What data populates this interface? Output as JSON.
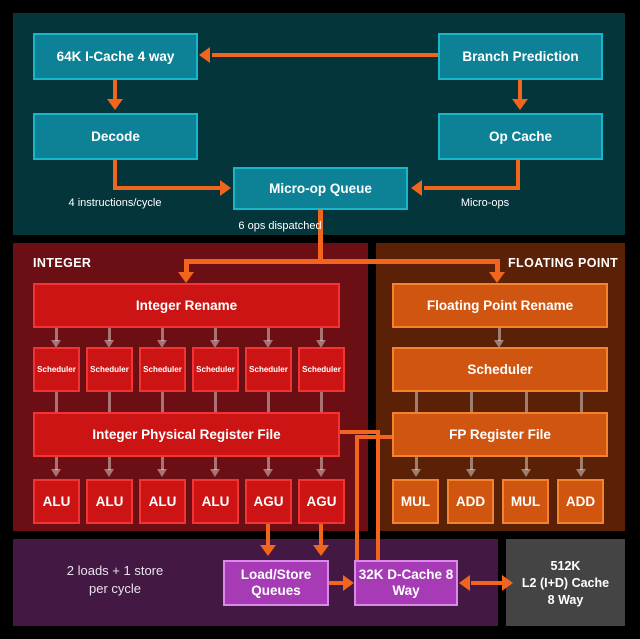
{
  "diagram": {
    "title": "CPU Microarchitecture Block Diagram",
    "background_color": "#000000"
  },
  "colors": {
    "frontend_panel": "#04353b",
    "integer_panel": "#6b0f14",
    "fp_panel": "#5a2107",
    "memory_panel": "#431842",
    "l2_panel": "#444444",
    "teal_box": "#0d8296",
    "teal_border": "#19b6cb",
    "red_box": "#cc1414",
    "red_border": "#f43434",
    "orange_box": "#cf5510",
    "orange_border": "#f3842f",
    "purple_box": "#a63bb5",
    "purple_border": "#d98ae8",
    "arrow": "#f2651c",
    "faint_arrow": "#ffffff"
  },
  "frontend": {
    "icache": "64K I-Cache\n4 way",
    "decode": "Decode",
    "branch_prediction": "Branch Prediction",
    "op_cache": "Op Cache",
    "microop_queue": "Micro-op Queue",
    "label_instructions_per_cycle": "4 instructions/cycle",
    "label_micro_ops": "Micro-ops",
    "label_ops_dispatched": "6 ops dispatched"
  },
  "integer": {
    "section_title": "INTEGER",
    "rename": "Integer Rename",
    "schedulers": [
      "Scheduler",
      "Scheduler",
      "Scheduler",
      "Scheduler",
      "Scheduler",
      "Scheduler"
    ],
    "register_file": "Integer Physical Register File",
    "execution_units": [
      "ALU",
      "ALU",
      "ALU",
      "ALU",
      "AGU",
      "AGU"
    ]
  },
  "floating_point": {
    "section_title": "FLOATING POINT",
    "rename": "Floating Point Rename",
    "scheduler": "Scheduler",
    "register_file": "FP Register File",
    "execution_units": [
      "MUL",
      "ADD",
      "MUL",
      "ADD"
    ]
  },
  "memory": {
    "note": "2 loads + 1 store\nper cycle",
    "load_store_queues": "Load/Store\nQueues",
    "d_cache": "32K D-Cache\n8 Way"
  },
  "l2_cache": {
    "text": "512K\nL2 (I+D) Cache\n8 Way"
  }
}
